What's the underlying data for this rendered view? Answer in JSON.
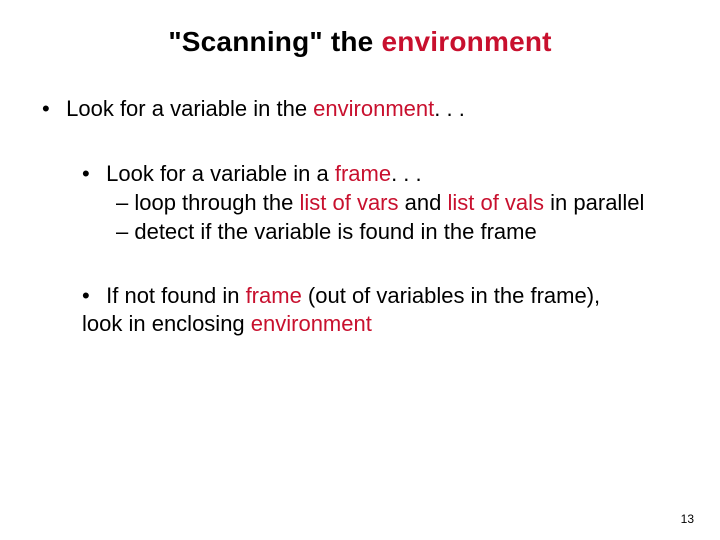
{
  "title_pre": "\"Scanning\" the ",
  "title_kw": "environment",
  "b1_pre": "Look for a variable in the ",
  "b1_kw": "environment",
  "b1_post": ". . .",
  "b2a_pre": "Look for a variable in a ",
  "b2a_kw": "frame",
  "b2a_post": ". . .",
  "b2a_s1_pre": "– loop through the ",
  "b2a_s1_kw1": "list of vars",
  "b2a_s1_mid": " and ",
  "b2a_s1_kw2": "list of vals",
  "b2a_s1_post": " in parallel",
  "b2a_s2": "– detect if the variable is found in the frame",
  "b2b_pre": "If not found in ",
  "b2b_kw": "frame",
  "b2b_mid": " (out of variables in the frame), look in enclosing ",
  "b2b_kw2": "environment",
  "page_number": "13"
}
